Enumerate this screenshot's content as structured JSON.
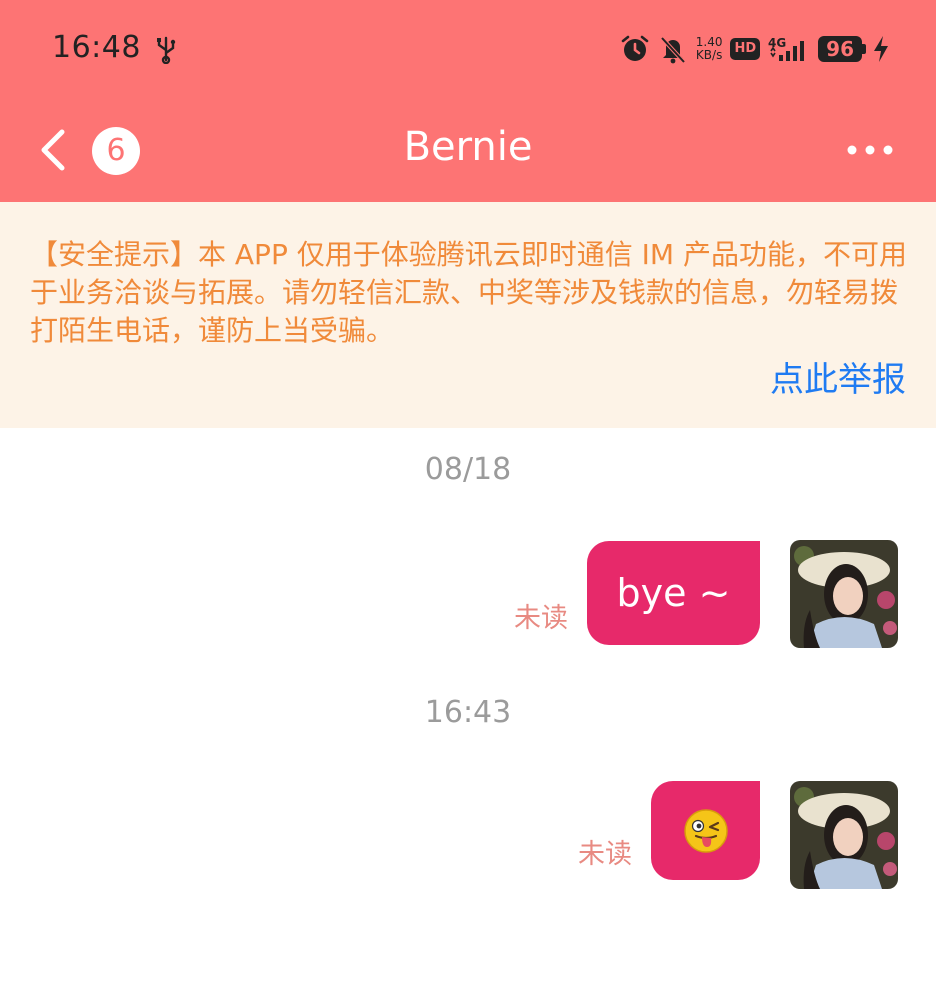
{
  "status_bar": {
    "time": "16:48",
    "net_speed_value": "1.40",
    "net_speed_unit": "KB/s",
    "hd_label": "HD",
    "network_label": "4G",
    "battery_level": "96",
    "icons": [
      "usb-icon",
      "alarm-icon",
      "mute-icon",
      "signal-icon",
      "charging-icon"
    ]
  },
  "nav": {
    "title": "Bernie",
    "unread_count": "6",
    "back_icon": "chevron-left-icon",
    "more_icon": "more-horizontal-icon"
  },
  "notice": {
    "text": "【安全提示】本 APP 仅用于体验腾讯云即时通信 IM 产品功能，不可用于业务洽谈与拓展。请勿轻信汇款、中奖等涉及钱款的信息，勿轻易拨打陌生电话，谨防上当受骗。",
    "report_link": "点此举报"
  },
  "messages": [
    {
      "time_divider": "08/18",
      "type": "text",
      "content": "bye ~",
      "status": "未读"
    },
    {
      "time_divider": "16:43",
      "type": "emoji",
      "content": "winking-tongue-emoji",
      "status": "未读"
    }
  ],
  "colors": {
    "header": "#fd7474",
    "bubble": "#e7296a",
    "notice_bg": "#fdf3e7",
    "notice_text": "#f08a3a",
    "link": "#1f7bf2",
    "status_unread": "#e88a82",
    "timestamp": "#9b9b9b"
  }
}
